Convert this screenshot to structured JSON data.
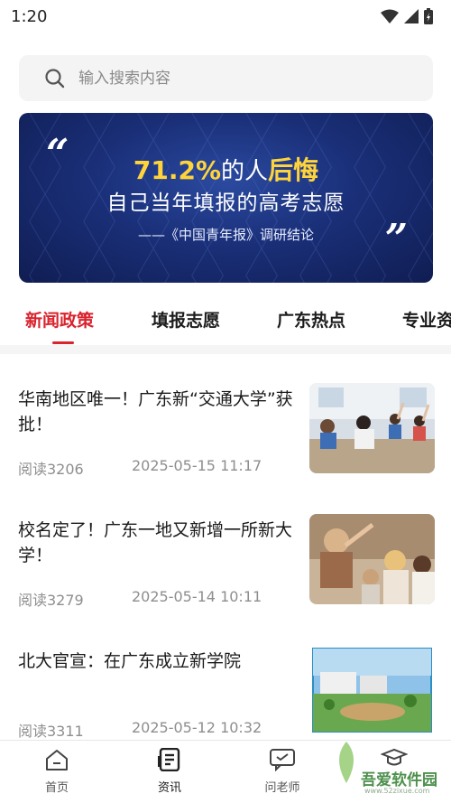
{
  "status_bar": {
    "time": "1:20"
  },
  "search": {
    "placeholder": "输入搜索内容"
  },
  "banner": {
    "percent": "71.2%",
    "line1_mid": "的人",
    "line1_highlight": "后悔",
    "line2": "自己当年填报的高考志愿",
    "source": "——《中国青年报》调研结论"
  },
  "tabs": [
    {
      "label": "新闻政策",
      "active": true
    },
    {
      "label": "填报志愿",
      "active": false
    },
    {
      "label": "广东热点",
      "active": false
    },
    {
      "label": "专业资",
      "active": false
    }
  ],
  "news": [
    {
      "title": "华南地区唯一！广东新“交通大学”获批！",
      "reads": "阅读3206",
      "date": "2025-05-15 11:17"
    },
    {
      "title": "校名定了！广东一地又新增一所新大学！",
      "reads": "阅读3279",
      "date": "2025-05-14 10:11"
    },
    {
      "title": "北大官宣：在广东成立新学院",
      "reads": "阅读3311",
      "date": "2025-05-12 10:32"
    }
  ],
  "tabbar": [
    {
      "label": "首页",
      "icon": "home-icon"
    },
    {
      "label": "资讯",
      "icon": "news-icon",
      "active": true
    },
    {
      "label": "问老师",
      "icon": "chat-icon"
    },
    {
      "label": "",
      "icon": "graduation-cap-icon"
    }
  ],
  "watermark": {
    "text": "吾爱软件园",
    "url": "www.52zixue.com"
  },
  "colors": {
    "accent": "#d9232d",
    "banner_bg": "#1a2f78",
    "highlight": "#ffd43b"
  }
}
